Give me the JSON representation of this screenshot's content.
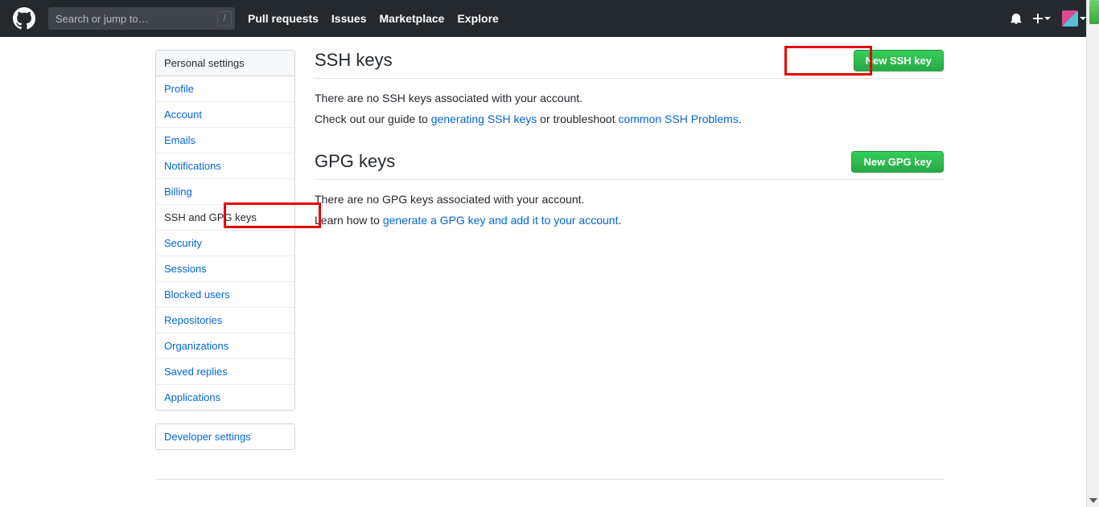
{
  "header": {
    "search_placeholder": "Search or jump to…",
    "slash_hint": "/",
    "nav": [
      "Pull requests",
      "Issues",
      "Marketplace",
      "Explore"
    ]
  },
  "sidebar": {
    "title": "Personal settings",
    "items": [
      "Profile",
      "Account",
      "Emails",
      "Notifications",
      "Billing",
      "SSH and GPG keys",
      "Security",
      "Sessions",
      "Blocked users",
      "Repositories",
      "Organizations",
      "Saved replies",
      "Applications"
    ],
    "active": "SSH and GPG keys",
    "dev_title": "Developer settings"
  },
  "ssh": {
    "heading": "SSH keys",
    "button": "New SSH key",
    "empty": "There are no SSH keys associated with your account.",
    "help_pre": "Check out our guide to ",
    "help_link1": "generating SSH keys",
    "help_mid": " or troubleshoot ",
    "help_link2": "common SSH Problems",
    "help_end": "."
  },
  "gpg": {
    "heading": "GPG keys",
    "button": "New GPG key",
    "empty": "There are no GPG keys associated with your account.",
    "help_pre": "Learn how to ",
    "help_link": "generate a GPG key and add it to your account",
    "help_end": "."
  }
}
